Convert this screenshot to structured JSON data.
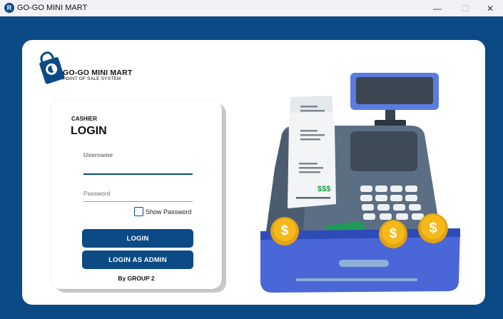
{
  "window": {
    "title": "GO-GO MINI MART",
    "icon": "app-icon",
    "minimize": "—",
    "maximize": "☐",
    "close": "✕"
  },
  "brand": {
    "name": "GO-GO MINI MART",
    "tagline": "POINT OF SALE SYSTEM"
  },
  "login": {
    "role_label": "CASHIER",
    "heading": "LOGIN",
    "username_placeholder": "Username",
    "username_value": "",
    "password_placeholder": "Password",
    "password_value": "",
    "show_password_label": "Show Password",
    "show_password_checked": false,
    "login_button": "LOGIN",
    "admin_button": "LOGIN AS ADMIN",
    "footer": "By GROUP 2"
  },
  "illustration": {
    "receipt_text": "$$$",
    "coin_symbol": "$"
  },
  "colors": {
    "primary": "#0b4a85",
    "register_body": "#5c6e83",
    "drawer": "#4a67d8",
    "coin": "#f5b91a"
  }
}
